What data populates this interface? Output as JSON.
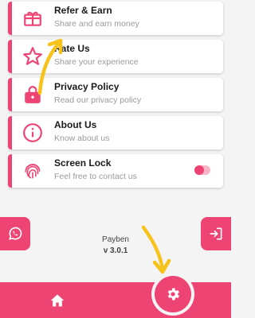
{
  "theme": {
    "accent": "#ee4474",
    "annotation": "#f7c21a"
  },
  "menu": [
    {
      "id": "refer",
      "icon": "gift-icon",
      "title": "Refer & Earn",
      "subtitle": "Share and earn money"
    },
    {
      "id": "rate",
      "icon": "star-icon",
      "title": "Rate Us",
      "subtitle": "Share your experience"
    },
    {
      "id": "privacy",
      "icon": "lock-icon",
      "title": "Privacy Policy",
      "subtitle": "Read our privacy policy"
    },
    {
      "id": "about",
      "icon": "info-icon",
      "title": "About Us",
      "subtitle": "Know about us"
    },
    {
      "id": "screenlock",
      "icon": "fingerprint-icon",
      "title": "Screen Lock",
      "subtitle": "Feel free to contact us",
      "toggle": false
    }
  ],
  "app": {
    "name": "Payben",
    "version": "v 3.0.1"
  },
  "side_buttons": {
    "left_icon": "whatsapp-icon",
    "right_icon": "logout-icon"
  },
  "bottom_nav": {
    "home_icon": "home-icon",
    "settings_icon": "gear-icon"
  }
}
